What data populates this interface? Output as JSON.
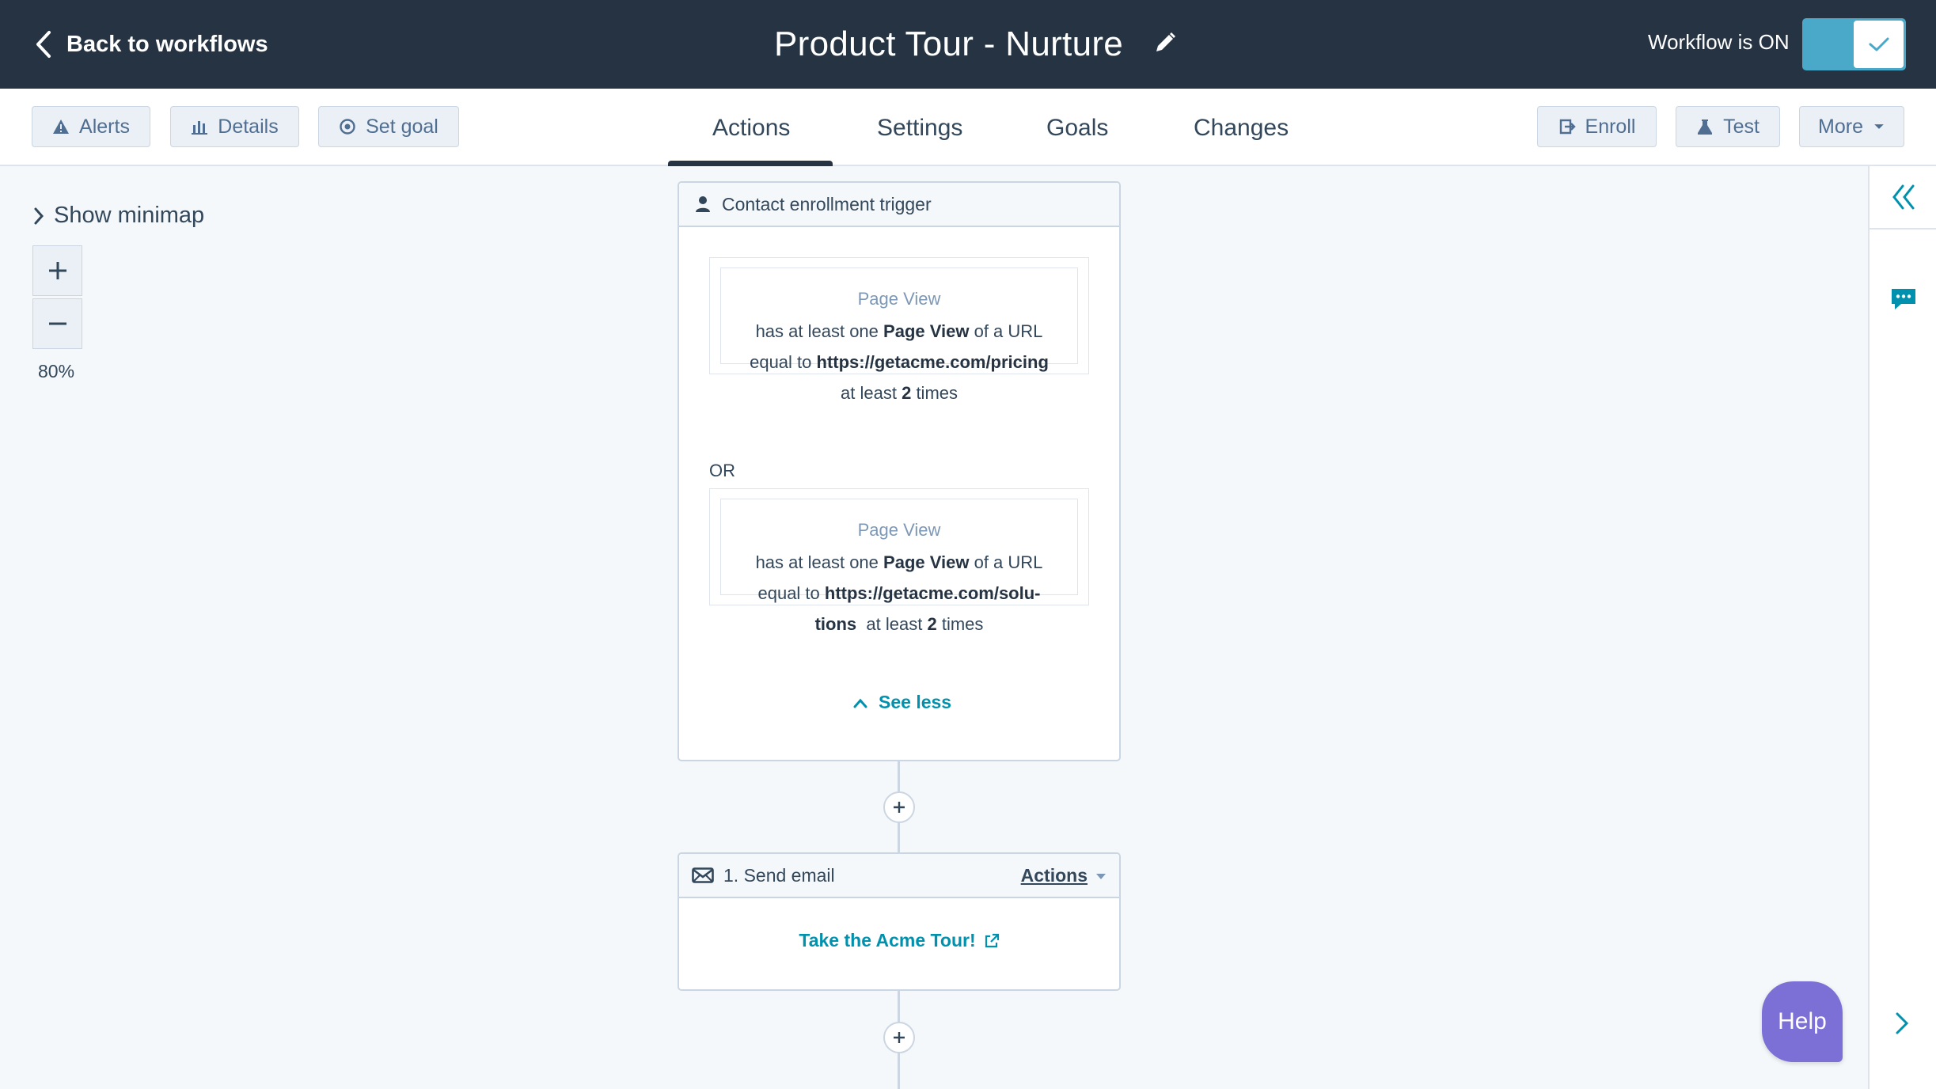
{
  "header": {
    "back_label": "Back to workflows",
    "workflow_title": "Product Tour - Nurture",
    "status_text": "Workflow is ON"
  },
  "toolbar": {
    "alerts_label": "Alerts",
    "details_label": "Details",
    "set_goal_label": "Set goal",
    "enroll_label": "Enroll",
    "test_label": "Test",
    "more_label": "More"
  },
  "tabs": [
    {
      "label": "Actions",
      "active": true
    },
    {
      "label": "Settings",
      "active": false
    },
    {
      "label": "Goals",
      "active": false
    },
    {
      "label": "Changes",
      "active": false
    }
  ],
  "canvas": {
    "show_minimap_label": "Show minimap",
    "zoom_level": "80%"
  },
  "trigger": {
    "header": "Contact enrollment trigger",
    "filters": [
      {
        "type": "Page View",
        "prefix": "has at least one",
        "object": "Page View",
        "mid": "of a URL",
        "equal_to": "equal to",
        "url": "https://getacme.com/pricing",
        "at_least": "at least",
        "count": "2",
        "times": "times"
      },
      {
        "type": "Page View",
        "prefix": "has at least one",
        "object": "Page View",
        "mid": "of a URL",
        "equal_to": "equal to",
        "url_part1": "https://getacme.com/solu-",
        "url_part2": "tions",
        "at_least": "at least",
        "count": "2",
        "times": "times"
      }
    ],
    "or_label": "OR",
    "see_less_label": "See less"
  },
  "action_1": {
    "header": "1. Send email",
    "actions_menu_label": "Actions",
    "email_name": "Take the Acme Tour!"
  },
  "help_label": "Help",
  "colors": {
    "topbar_bg": "#253342",
    "toggle_on": "#4aa8c9",
    "link": "#0091ae",
    "help_bg": "#7c6fd6"
  }
}
